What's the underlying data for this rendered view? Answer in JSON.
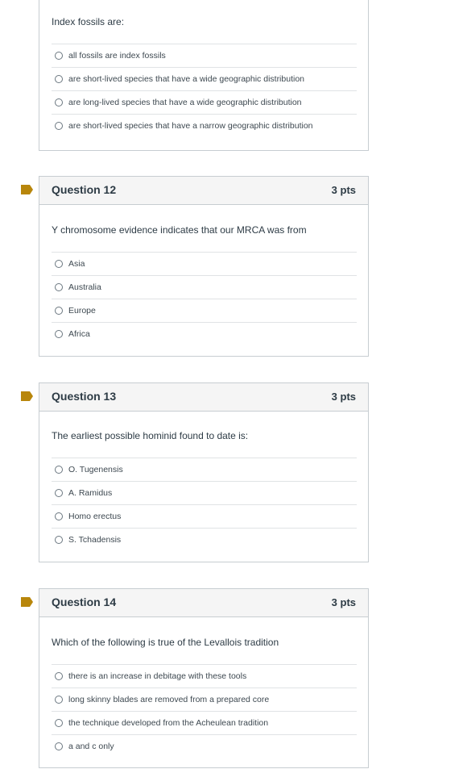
{
  "accent_color": "#b8860b",
  "questions": [
    {
      "number_label": "",
      "points": "",
      "text": "Index fossils are:",
      "answers": [
        "all fossils are index fossils",
        "are short-lived species that have a wide geographic distribution",
        "are long-lived species that have a wide geographic distribution",
        "are short-lived species that have a narrow geographic distribution"
      ]
    },
    {
      "number_label": "Question 12",
      "points": "3 pts",
      "text": "Y chromosome evidence indicates that our MRCA was from",
      "answers": [
        "Asia",
        "Australia",
        "Europe",
        "Africa"
      ]
    },
    {
      "number_label": "Question 13",
      "points": "3 pts",
      "text": "The earliest possible hominid found to date is:",
      "answers": [
        "O. Tugenensis",
        "A. Ramidus",
        "Homo erectus",
        "S. Tchadensis"
      ]
    },
    {
      "number_label": "Question 14",
      "points": "3 pts",
      "text": "Which of the following is true of the Levallois tradition",
      "answers": [
        "there is an increase in debitage with these tools",
        "long skinny blades are removed from a prepared core",
        "the technique developed from the Acheulean tradition",
        "a and c only"
      ]
    }
  ]
}
